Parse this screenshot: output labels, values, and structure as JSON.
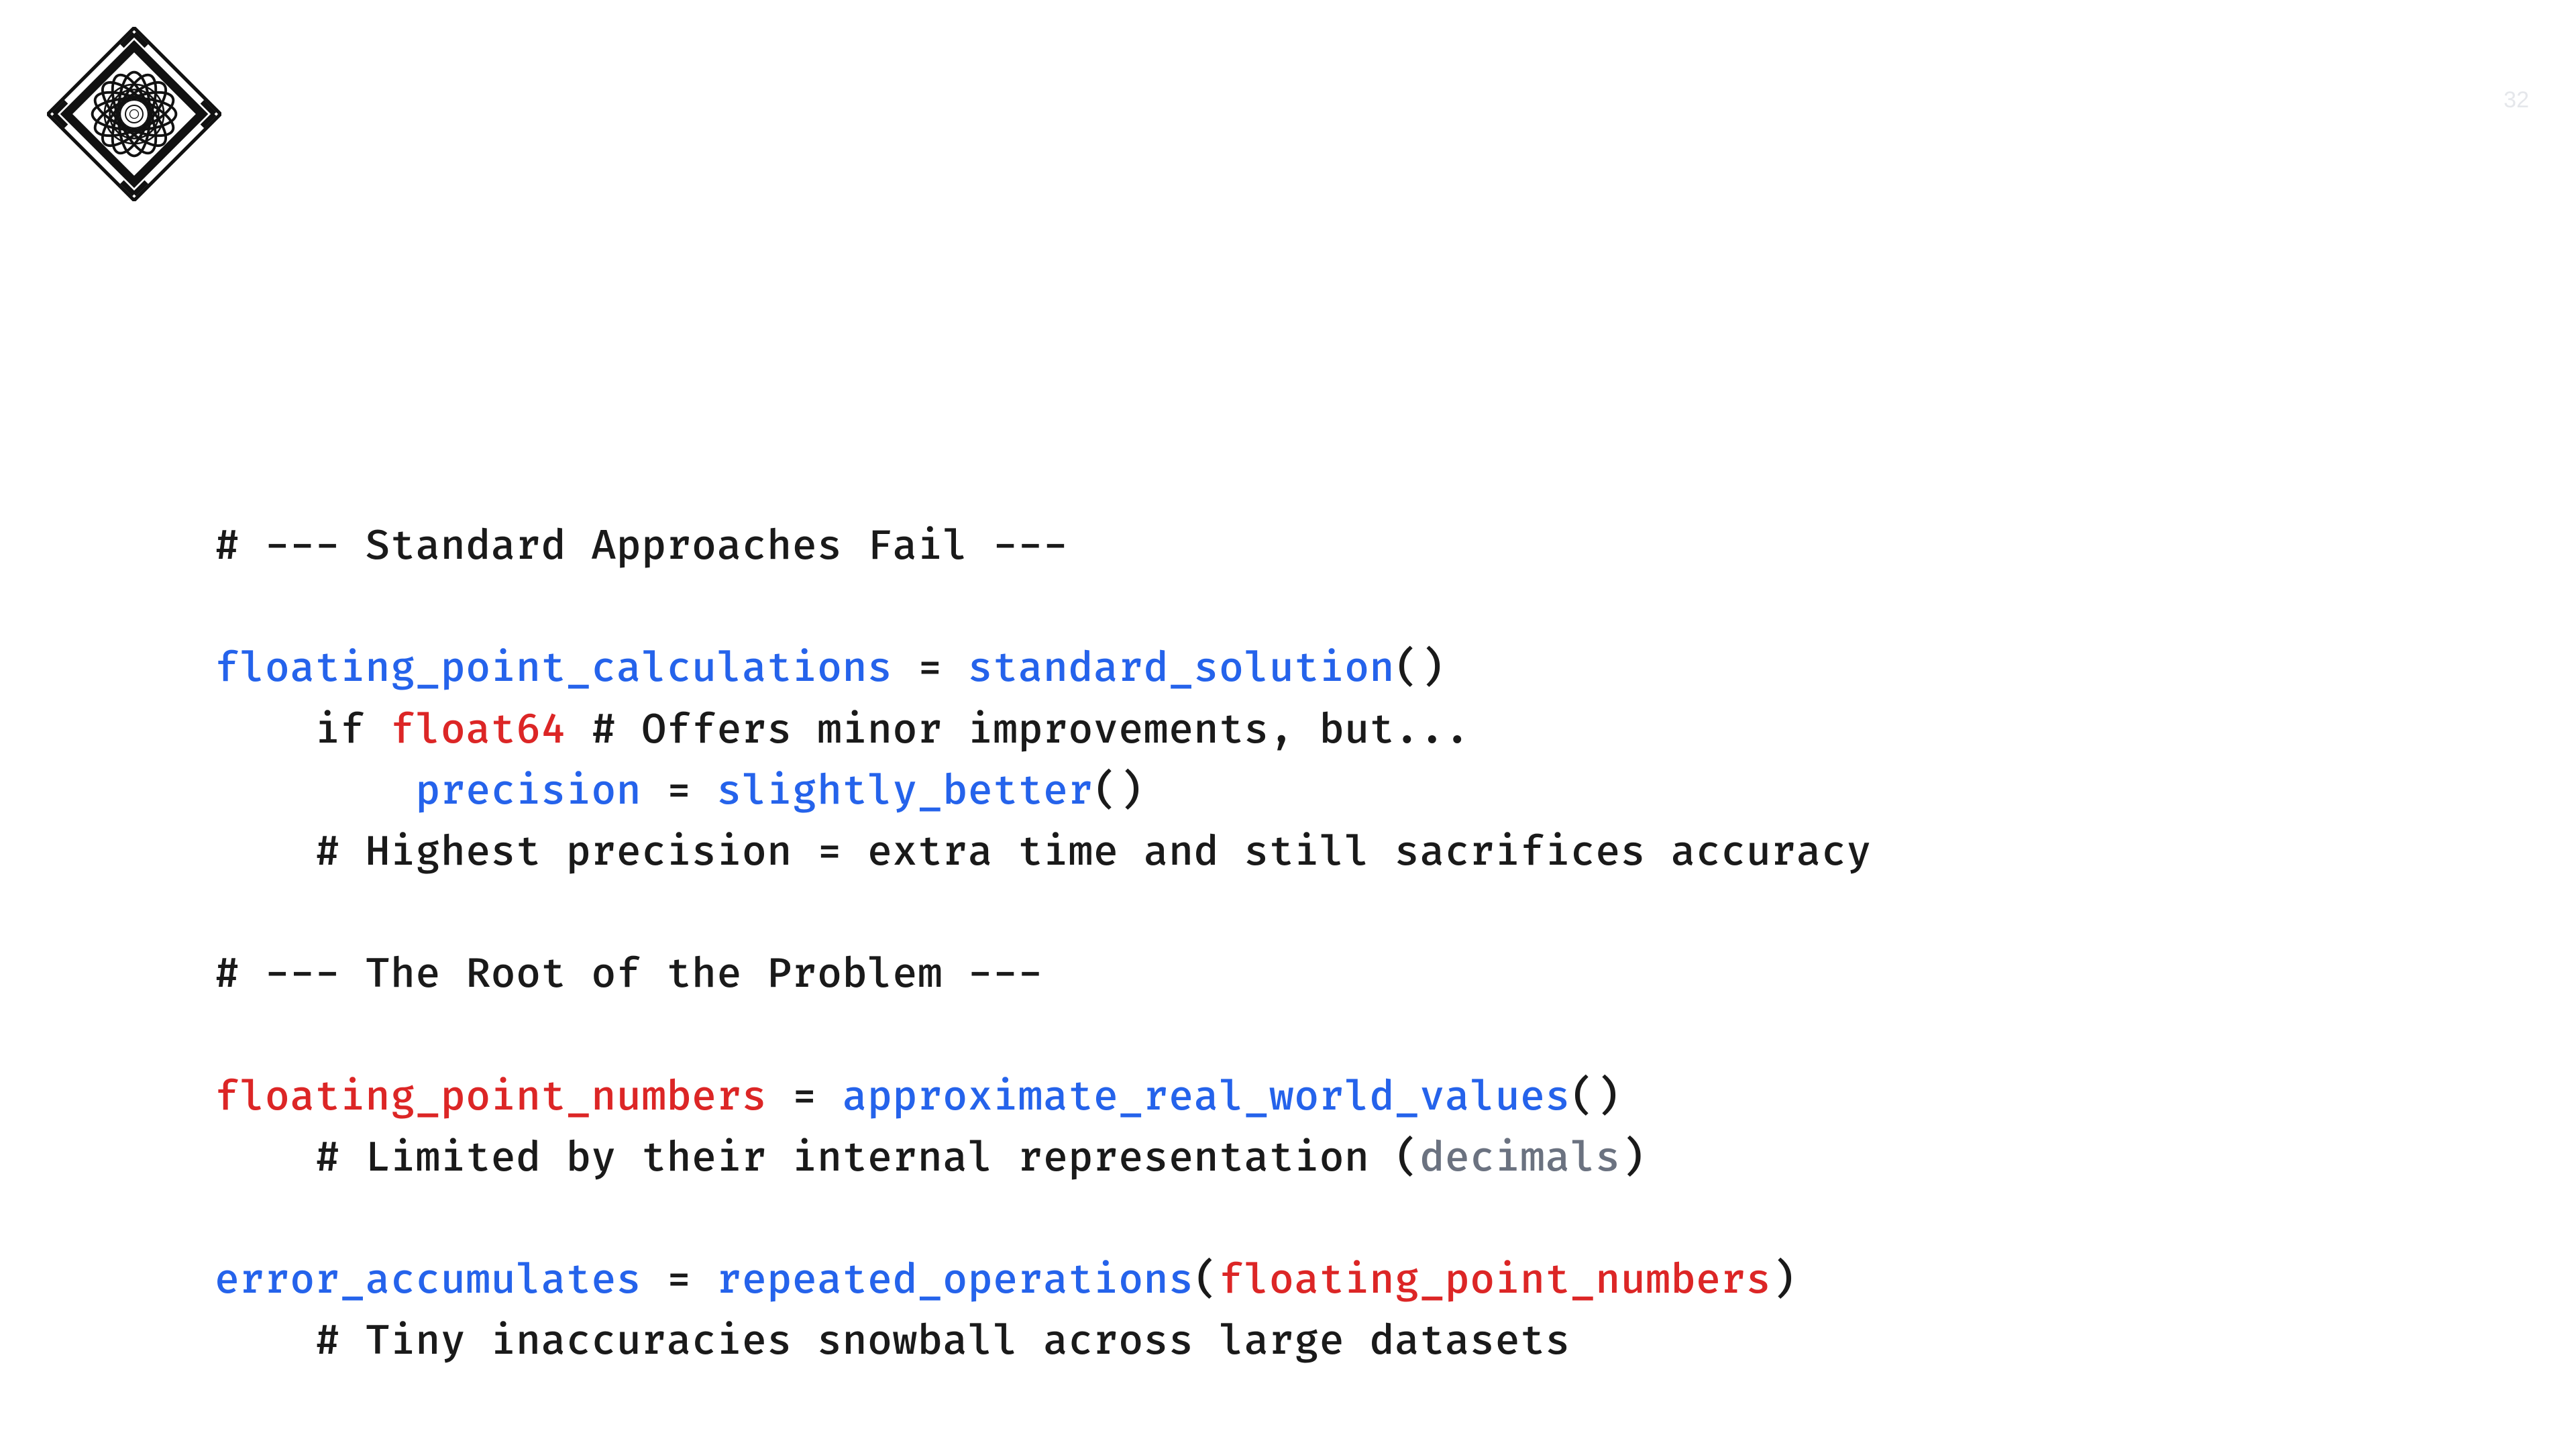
{
  "page_number": "32",
  "code": {
    "section1_title": "# --- Standard Approaches Fail ---",
    "l1_var": "floating_point_calculations",
    "l1_eq": " = ",
    "l1_func": "standard_solution",
    "l1_paren": "()",
    "l2_indent": "    ",
    "l2_if": "if ",
    "l2_cond": "float64",
    "l2_comment": " # Offers minor improvements, but...",
    "l3_indent": "        ",
    "l3_var": "precision",
    "l3_eq": " = ",
    "l3_func": "slightly_better",
    "l3_paren": "()",
    "l4_indent": "    ",
    "l4_comment": "# Highest precision = extra time and still sacrifices accuracy",
    "section2_title": "# --- The Root of the Problem ---",
    "l5_var": "floating_point_numbers",
    "l5_eq": " = ",
    "l5_func": "approximate_real_world_values",
    "l5_paren": "()",
    "l6_indent": "    ",
    "l6_comment_a": "# Limited by their internal representation (",
    "l6_dim": "decimals",
    "l6_comment_b": ")",
    "l7_var": "error_accumulates",
    "l7_eq": " = ",
    "l7_func": "repeated_operations",
    "l7_open": "(",
    "l7_arg": "floating_point_numbers",
    "l7_close": ")",
    "l8_indent": "    ",
    "l8_comment": "# Tiny inaccuracies snowball across large datasets"
  }
}
